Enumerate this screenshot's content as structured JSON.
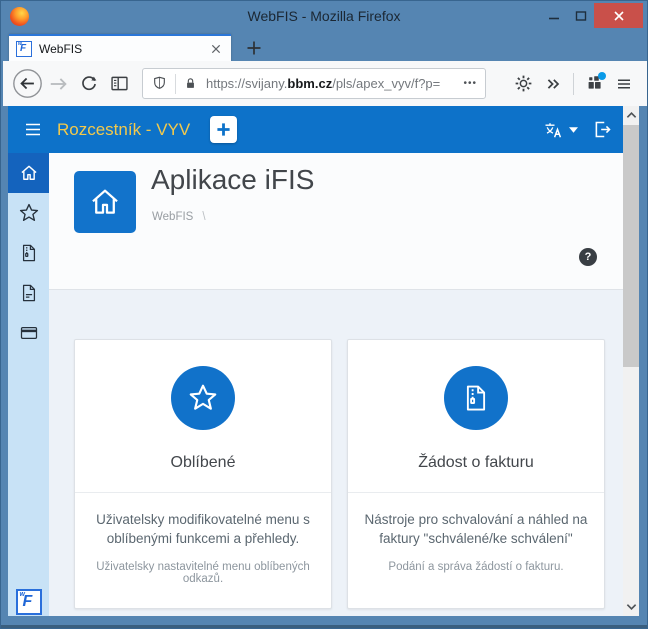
{
  "window": {
    "title": "WebFIS - Mozilla Firefox"
  },
  "tabbar": {
    "tab_label": "WebFIS"
  },
  "toolbar": {
    "url_prefix": "https://svijany.",
    "url_domain": "bbm.cz",
    "url_path": "/pls/apex_vyv/f?p=",
    "url_truncation": "•••"
  },
  "app_header": {
    "title": "Rozcestník - VYV"
  },
  "sidebar": {
    "items": [
      {
        "icon": "home"
      },
      {
        "icon": "star"
      },
      {
        "icon": "invoice-request"
      },
      {
        "icon": "document"
      },
      {
        "icon": "payment-card"
      }
    ]
  },
  "logo": {
    "small": "w",
    "big": "F"
  },
  "page": {
    "title": "Aplikace iFIS",
    "breadcrumb": "WebFIS",
    "breadcrumb_separator": "\\",
    "help": "?",
    "cards": [
      {
        "icon": "star",
        "label": "Oblíbené",
        "description": "Uživatelsky modifikovatelné menu s oblíbenými funkcemi a přehledy.",
        "note": "Uživatelsky nastavitelné menu oblíbených odkazů."
      },
      {
        "icon": "invoice-document",
        "label": "Žádost o fakturu",
        "description": "Nástroje pro schvalování a náhled na faktury \"schválené/ke schválení\"",
        "note": "Podání a správa žádostí o fakturu."
      }
    ]
  },
  "colors": {
    "titlebar_steel": "#5585b2",
    "close_red": "#c9504a",
    "tab_accent_blue": "#2a76d8",
    "app_blue": "#0d72c9",
    "header_title_gold": "#f2c94c",
    "sidebar_light_blue": "#c8e2f6",
    "sidebar_active_blue": "#1463bd",
    "card_circle_blue": "#1172ca",
    "notification_dot_blue": "#0a9ae8"
  }
}
